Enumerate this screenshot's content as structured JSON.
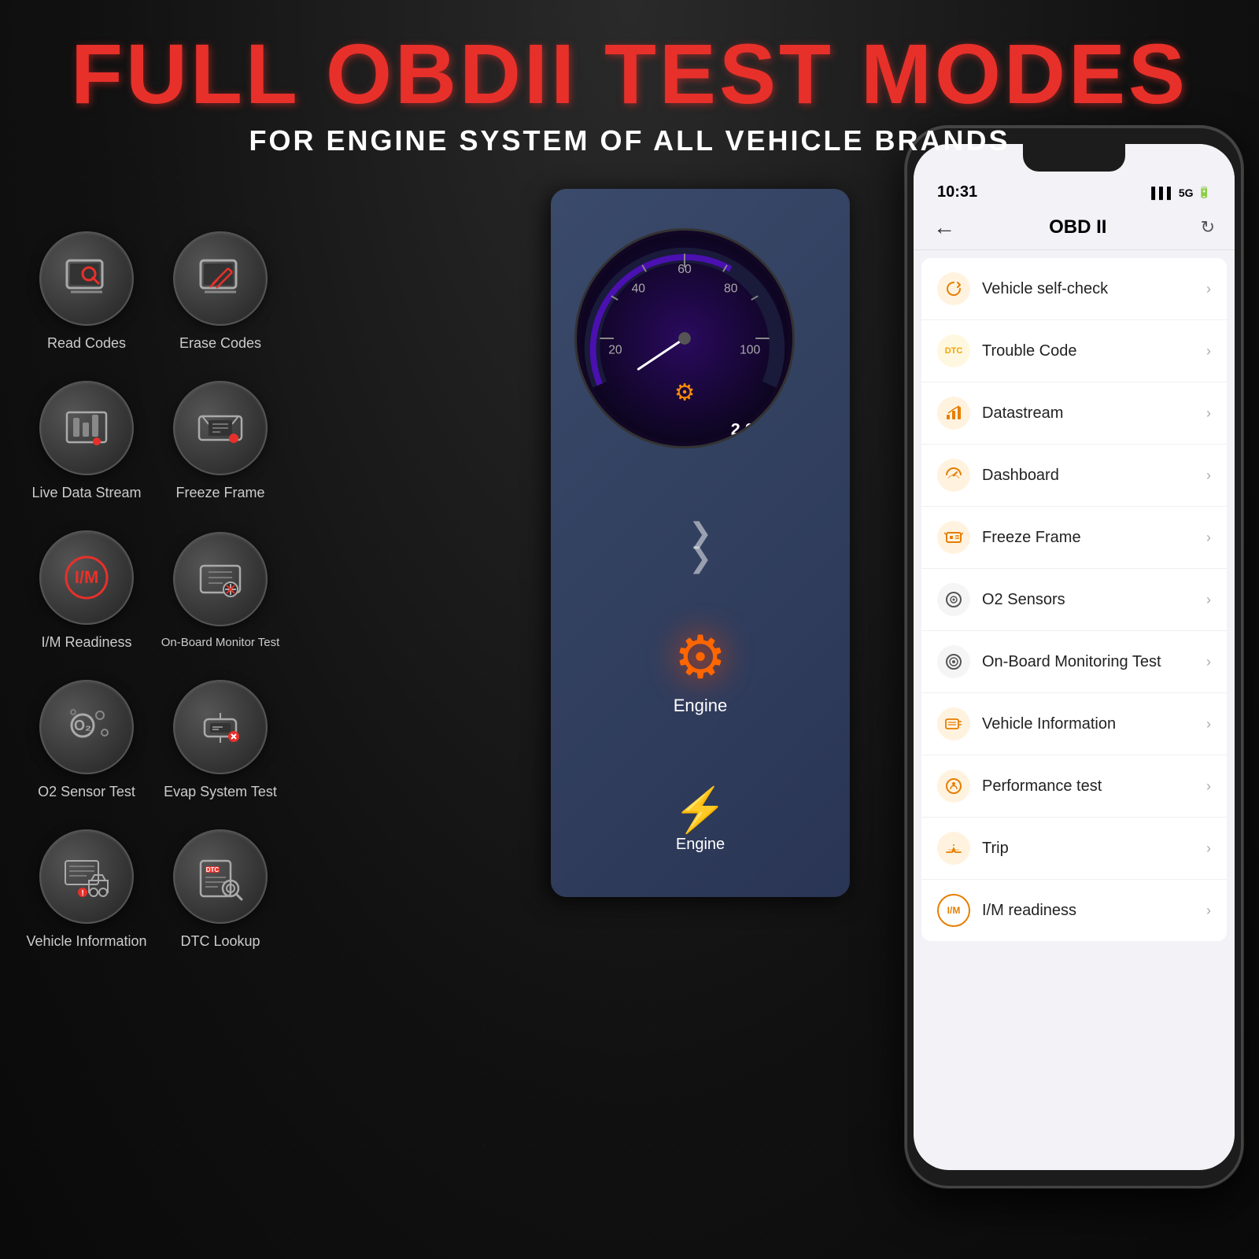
{
  "header": {
    "main_title": "FULL OBDII TEST MODES",
    "sub_title": "FOR ENGINE SYSTEM OF ALL VEHICLE BRANDS"
  },
  "left_icons": [
    {
      "id": "read-codes",
      "label": "Read Codes",
      "icon": "🔍"
    },
    {
      "id": "erase-codes",
      "label": "Erase Codes",
      "icon": "🗑"
    },
    {
      "id": "live-data-stream",
      "label": "Live Data Stream",
      "icon": "📊"
    },
    {
      "id": "freeze-frame",
      "label": "Freeze Frame",
      "icon": "❄"
    },
    {
      "id": "im-readiness",
      "label": "I/M Readiness",
      "icon": "IM"
    },
    {
      "id": "on-board-monitor",
      "label": "On-Board Monitor Test",
      "icon": "⚙"
    },
    {
      "id": "o2-sensor",
      "label": "O2 Sensor Test",
      "icon": "O₂"
    },
    {
      "id": "evap-system",
      "label": "Evap System Test",
      "icon": "🔧"
    },
    {
      "id": "vehicle-information",
      "label": "Vehicle Information",
      "icon": "🚗"
    },
    {
      "id": "dtc-lookup",
      "label": "DTC Lookup",
      "icon": "🔎"
    }
  ],
  "phone": {
    "time": "10:31",
    "signal": "5G",
    "title": "OBD II",
    "back_label": "←",
    "refresh_label": "↻",
    "menu_items": [
      {
        "id": "vehicle-self-check",
        "label": "Vehicle self-check",
        "icon": "⟳",
        "color": "ic-orange"
      },
      {
        "id": "trouble-code",
        "label": "Trouble Code",
        "icon": "DTC",
        "color": "ic-yellow"
      },
      {
        "id": "datastream",
        "label": "Datastream",
        "icon": "📈",
        "color": "ic-orange"
      },
      {
        "id": "dashboard",
        "label": "Dashboard",
        "icon": "🏎",
        "color": "ic-orange"
      },
      {
        "id": "freeze-frame",
        "label": "Freeze Frame",
        "icon": "📊",
        "color": "ic-orange"
      },
      {
        "id": "o2-sensors",
        "label": "O2 Sensors",
        "icon": "⊙",
        "color": "ic-gray"
      },
      {
        "id": "on-board-monitoring",
        "label": "On-Board Monitoring Test",
        "icon": "◎",
        "color": "ic-gray"
      },
      {
        "id": "vehicle-information",
        "label": "Vehicle Information",
        "icon": "📋",
        "color": "ic-orange"
      },
      {
        "id": "performance-test",
        "label": "Performance test",
        "icon": "⚡",
        "color": "ic-orange"
      },
      {
        "id": "trip",
        "label": "Trip",
        "icon": "🛣",
        "color": "ic-orange"
      },
      {
        "id": "im-readiness",
        "label": "I/M readiness",
        "icon": "IM",
        "color": "ic-orange"
      }
    ]
  }
}
